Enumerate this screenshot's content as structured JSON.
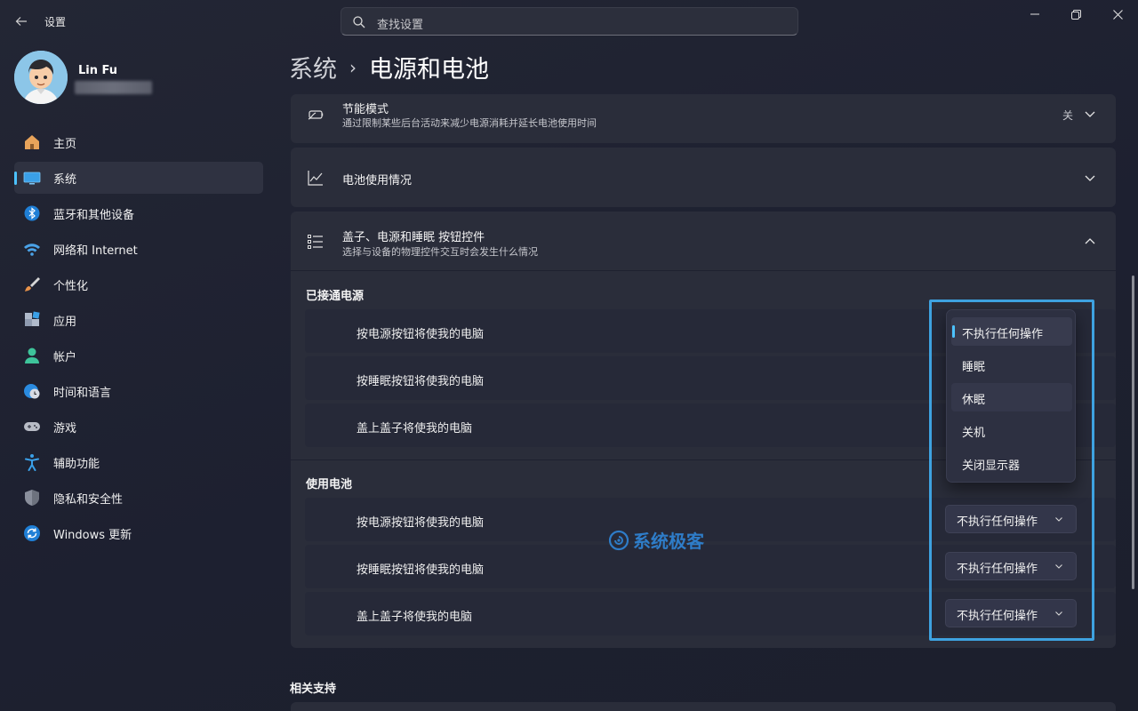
{
  "window": {
    "app_title": "设置",
    "controls": [
      "minimize",
      "restore",
      "close"
    ]
  },
  "search": {
    "placeholder": "查找设置",
    "icon": "search-icon"
  },
  "profile": {
    "name": "Lin Fu",
    "email_redacted": true
  },
  "sidebar": {
    "items": [
      {
        "label": "主页",
        "icon": "home-icon",
        "active": false
      },
      {
        "label": "系统",
        "icon": "system-display-icon",
        "active": true
      },
      {
        "label": "蓝牙和其他设备",
        "icon": "bluetooth-icon",
        "active": false
      },
      {
        "label": "网络和 Internet",
        "icon": "wifi-icon",
        "active": false
      },
      {
        "label": "个性化",
        "icon": "brush-icon",
        "active": false
      },
      {
        "label": "应用",
        "icon": "apps-icon",
        "active": false
      },
      {
        "label": "帐户",
        "icon": "account-icon",
        "active": false
      },
      {
        "label": "时间和语言",
        "icon": "time-language-icon",
        "active": false
      },
      {
        "label": "游戏",
        "icon": "gamepad-icon",
        "active": false
      },
      {
        "label": "辅助功能",
        "icon": "accessibility-icon",
        "active": false
      },
      {
        "label": "隐私和安全性",
        "icon": "shield-icon",
        "active": false
      },
      {
        "label": "Windows 更新",
        "icon": "update-icon",
        "active": false
      }
    ]
  },
  "breadcrumb": {
    "parent": "系统",
    "separator": "›",
    "current": "电源和电池"
  },
  "cards": {
    "energy_saver": {
      "title": "节能模式",
      "subtitle": "通过限制某些后台活动来减少电源消耗并延长电池使用时间",
      "value": "关"
    },
    "battery_usage": {
      "title": "电池使用情况"
    },
    "lid_power_buttons": {
      "title": "盖子、电源和睡眠 按钮控件",
      "subtitle": "选择与设备的物理控件交互时会发生什么情况"
    }
  },
  "plugged_in": {
    "label": "已接通电源",
    "rows": [
      {
        "label": "按电源按钮将使我的电脑"
      },
      {
        "label": "按睡眠按钮将使我的电脑"
      },
      {
        "label": "盖上盖子将使我的电脑"
      }
    ]
  },
  "on_battery": {
    "label": "使用电池",
    "rows": [
      {
        "label": "按电源按钮将使我的电脑",
        "value": "不执行任何操作"
      },
      {
        "label": "按睡眠按钮将使我的电脑",
        "value": "不执行任何操作"
      },
      {
        "label": "盖上盖子将使我的电脑",
        "value": "不执行任何操作"
      }
    ]
  },
  "dropdown_menu": {
    "options": [
      "不执行任何操作",
      "睡眠",
      "休眠",
      "关机",
      "关闭显示器"
    ],
    "selected": "不执行任何操作",
    "hovered": "休眠"
  },
  "watermark": {
    "text": "系统极客"
  },
  "related": {
    "label": "相关支持"
  },
  "colors": {
    "accent": "#4cc2ff",
    "highlight_box": "#3ea2e0",
    "watermark": "#2f86d8"
  }
}
